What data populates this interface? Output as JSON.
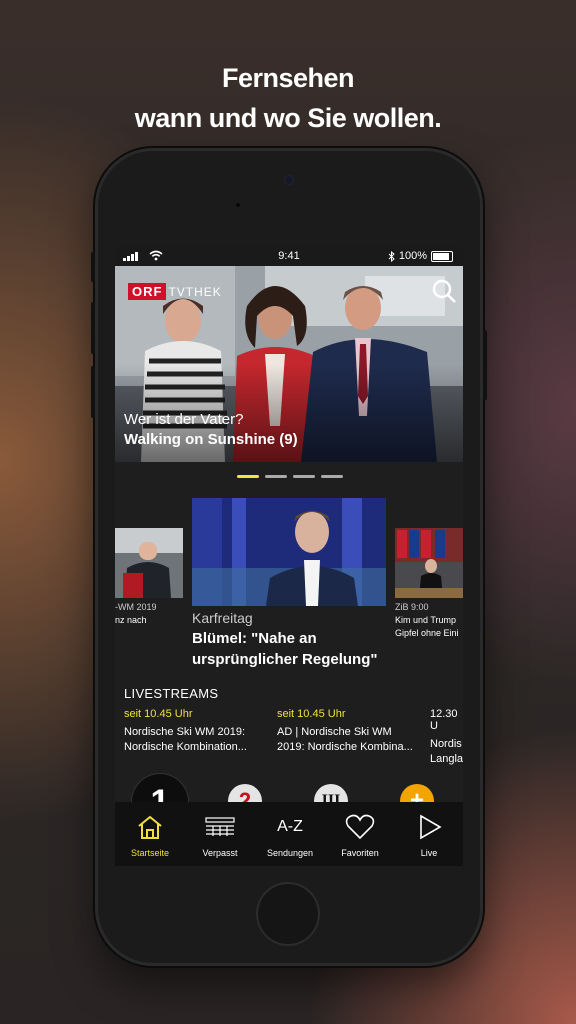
{
  "headline": {
    "line1": "Fernsehen",
    "line2": "wann und wo Sie wollen."
  },
  "statusbar": {
    "time": "9:41",
    "battery": "100%"
  },
  "hero": {
    "logo_orf": "ORF",
    "logo_tvthek": "TVTHEK",
    "subtitle": "Wer ist der Vater?",
    "title": "Walking on Sunshine (9)",
    "slides": 4,
    "active_slide": 1
  },
  "carousel": {
    "left_card": {
      "meta": "-WM 2019",
      "title": "nz nach"
    },
    "main_card": {
      "meta": "Karfreitag",
      "title": "Blümel: \"Nahe an ursprünglicher Regelung\""
    },
    "right_card": {
      "meta": "ZiB 9:00",
      "title_line1": "Kim und Trump",
      "title_line2": "Gipfel ohne Eini"
    }
  },
  "livestreams": {
    "header": "LIVESTREAMS",
    "items": [
      {
        "time": "seit 10.45 Uhr",
        "line1": "Nordische Ski WM 2019:",
        "line2": "Nordische Kombination..."
      },
      {
        "time": "seit 10.45 Uhr",
        "line1": "AD | Nordische Ski WM",
        "line2": "2019: Nordische Kombina..."
      },
      {
        "time": "12.30 U",
        "line1": "Nordis",
        "line2": "Langla"
      }
    ]
  },
  "channels": {
    "orf1": "1",
    "orf2": "2",
    "orf3": "III",
    "orfplus": "+"
  },
  "tabbar": {
    "items": [
      {
        "label": "Startseite",
        "icon": "home-icon"
      },
      {
        "label": "Verpasst",
        "icon": "schedule-icon"
      },
      {
        "label": "Sendungen",
        "icon_text": "A-Z",
        "icon": "az-icon"
      },
      {
        "label": "Favoriten",
        "icon": "heart-icon"
      },
      {
        "label": "Live",
        "icon": "play-icon"
      }
    ]
  },
  "colors": {
    "accent_yellow": "#f0e03a",
    "orf_red": "#d0102a"
  }
}
